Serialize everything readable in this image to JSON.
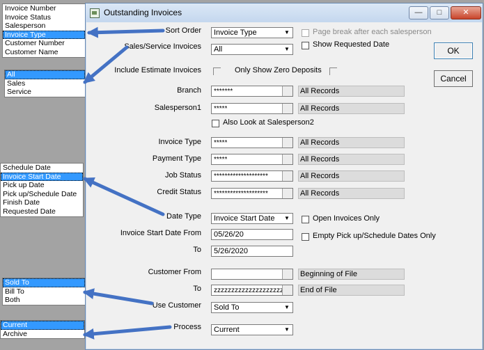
{
  "dialog": {
    "title": "Outstanding Invoices",
    "ok_label": "OK",
    "cancel_label": "Cancel",
    "close_glyph": "✕",
    "minimize_glyph": "—",
    "maximize_glyph": "□"
  },
  "form": {
    "sort_order": {
      "label": "Sort Order",
      "value": "Invoice Type"
    },
    "page_break": {
      "label": "Page break after each salesperson",
      "checked": false,
      "enabled": false
    },
    "show_requested": {
      "label": "Show Requested Date",
      "checked": false
    },
    "sales_service": {
      "label": "Sales/Service Invoices",
      "value": "All"
    },
    "include_estimate": {
      "label": "Include Estimate Invoices",
      "checked": false
    },
    "zero_deposits": {
      "label": "Only Show Zero Deposits",
      "checked": false
    },
    "branch": {
      "label": "Branch",
      "value": "*******",
      "range": "All Records"
    },
    "salesperson1": {
      "label": "Salesperson1",
      "value": "*****",
      "range": "All Records"
    },
    "also_look": {
      "label": "Also Look at Salesperson2",
      "checked": false
    },
    "invoice_type": {
      "label": "Invoice Type",
      "value": "*****",
      "range": "All Records"
    },
    "payment_type": {
      "label": "Payment Type",
      "value": "*****",
      "range": "All Records"
    },
    "job_status": {
      "label": "Job Status",
      "value": "********************",
      "range": "All Records"
    },
    "credit_status": {
      "label": "Credit Status",
      "value": "********************",
      "range": "All Records"
    },
    "date_type": {
      "label": "Date Type",
      "value": "Invoice Start Date"
    },
    "open_only": {
      "label": "Open Invoices Only",
      "checked": false
    },
    "date_from": {
      "label": "Invoice Start Date From",
      "value": "05/26/20"
    },
    "empty_pickup": {
      "label": "Empty Pick up/Schedule Dates Only",
      "checked": false
    },
    "date_to": {
      "label": "To",
      "value": "5/26/2020"
    },
    "customer_from": {
      "label": "Customer From",
      "value": "",
      "range": "Beginning of File"
    },
    "customer_to": {
      "label": "To",
      "value": "zzzzzzzzzzzzzzzzzzzz",
      "range": "End of File"
    },
    "use_customer": {
      "label": "Use Customer",
      "value": "Sold To"
    },
    "process": {
      "label": "Process",
      "value": "Current"
    }
  },
  "option_lists": {
    "sort_order": {
      "items": [
        "Invoice Number",
        "Invoice Status",
        "Salesperson",
        "Invoice Type",
        "Customer Number",
        "Customer Name"
      ],
      "selected": 3
    },
    "sales_service": {
      "items": [
        "All",
        "Sales",
        "Service"
      ],
      "selected": 0
    },
    "date_type": {
      "items": [
        "Schedule Date",
        "Invoice Start Date",
        "Pick up Date",
        "Pick up/Schedule Date",
        "Finish Date",
        "Requested Date"
      ],
      "selected": 1
    },
    "use_customer": {
      "items": [
        "Sold To",
        "Bill To",
        "Both"
      ],
      "selected": 0
    },
    "process": {
      "items": [
        "Current",
        "Archive"
      ],
      "selected": 0
    }
  },
  "colors": {
    "arrow": "#4472c4",
    "selection": "#3399ff",
    "backdrop": "#a3a3a3"
  }
}
